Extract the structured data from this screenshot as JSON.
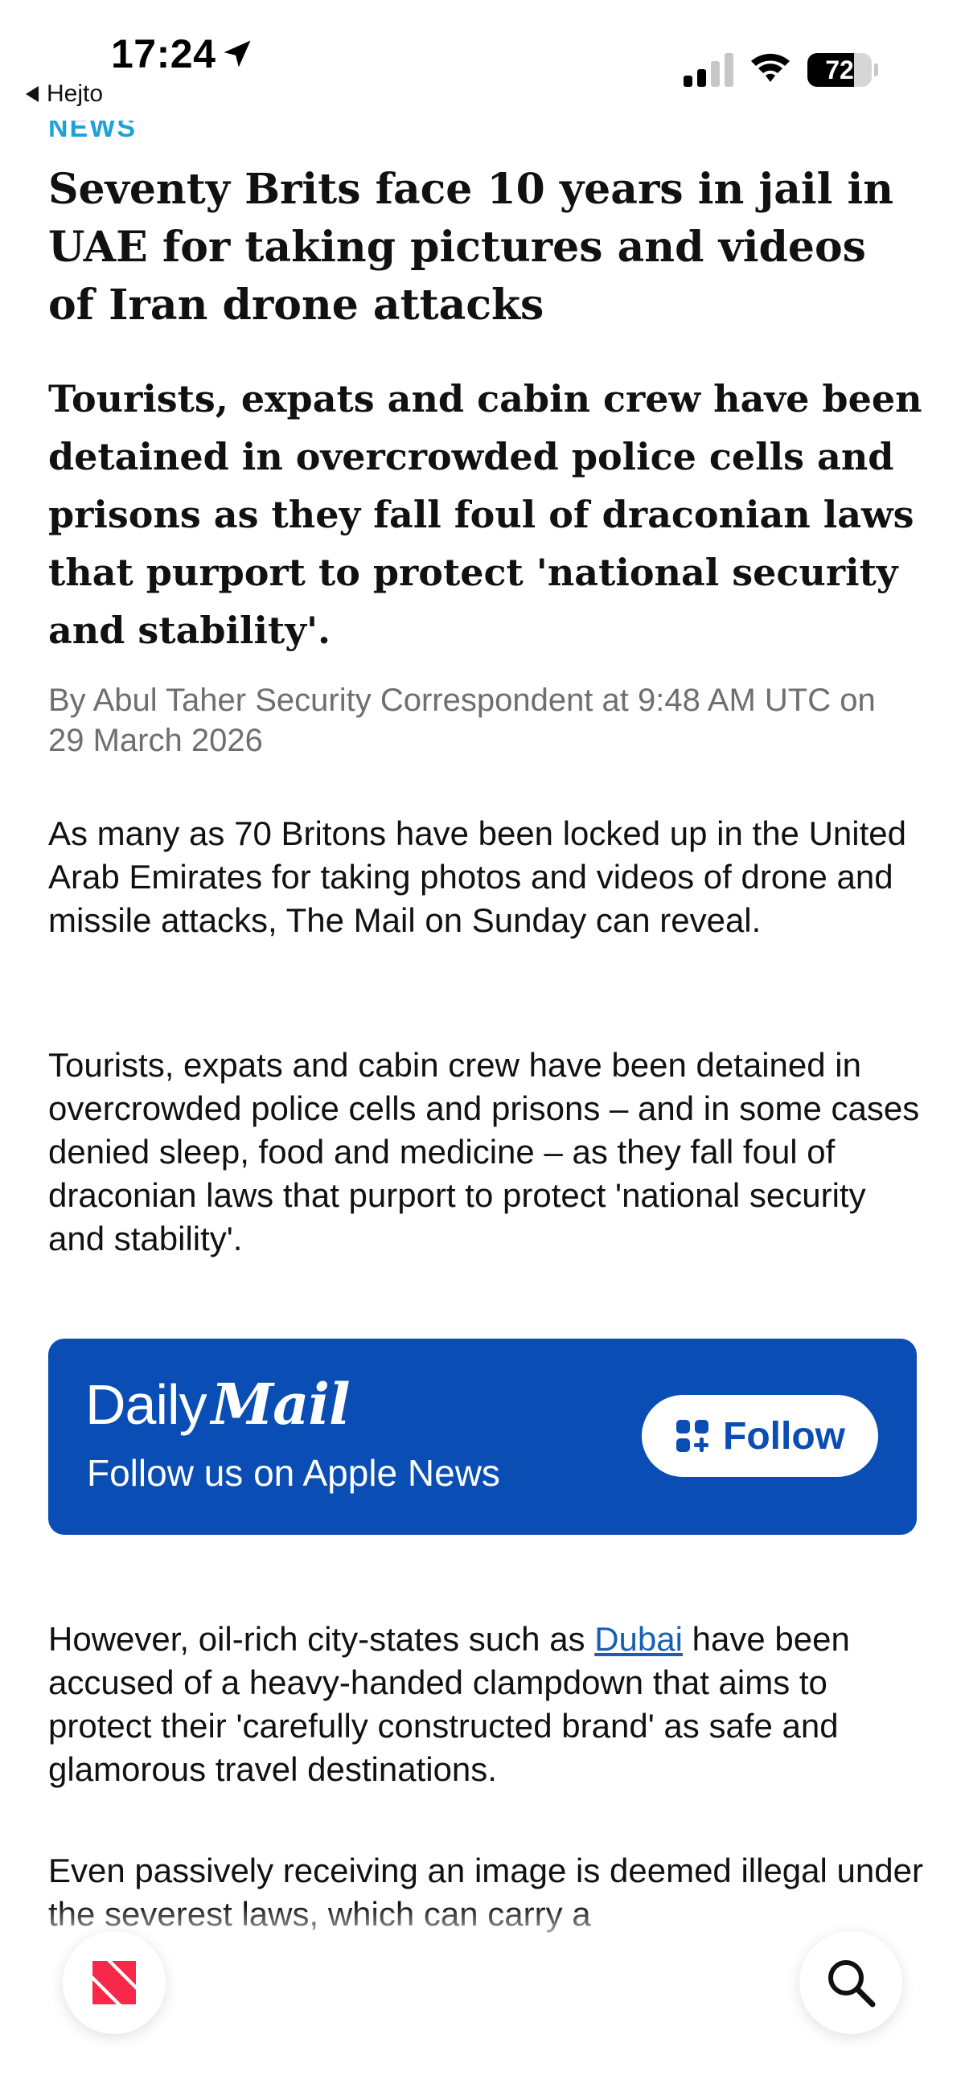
{
  "status_bar": {
    "time": "17:24",
    "back_label": "Hejto",
    "battery_level": 72,
    "battery_text": "72"
  },
  "article": {
    "section": "NEWS",
    "headline": "Seventy Brits face 10 years in jail in UAE for taking pictures and videos of Iran drone attacks",
    "standfirst": "Tourists, expats and cabin crew have been detained in overcrowded police cells and prisons as they fall foul of draconian laws that purport to protect 'national security and stability'.",
    "byline": "By Abul Taher Security Correspondent at 9:48 AM UTC on 29 March 2026",
    "paragraphs": [
      "As many as 70 Britons have been locked up in the United Arab Emirates for taking photos and videos of drone and missile attacks, The Mail on Sunday can reveal.",
      "Tourists, expats and cabin crew have been detained in overcrowded police cells and prisons – and in some cases denied sleep, food and medicine – as they fall foul of draconian laws that purport to protect 'national security and stability'."
    ],
    "para3_before": "However, oil-rich city-states such as ",
    "para3_link": "Dubai",
    "para3_after": " have been accused of a heavy-handed clampdown that aims to protect their 'carefully constructed brand' as safe and glamorous travel destinations.",
    "para4": "Even passively receiving an image is deemed illegal under the severest laws, which can carry a"
  },
  "promo": {
    "brand_daily": "Daily",
    "brand_mail": "Mail",
    "tagline": "Follow us on Apple News",
    "follow_label": "Follow",
    "background_color": "#0a4db4"
  },
  "icons": {
    "location": "location-arrow-icon",
    "signal": "cellular-signal-icon",
    "wifi": "wifi-icon",
    "battery": "battery-icon",
    "apple_news": "apple-news-icon",
    "search": "search-icon",
    "follow": "follow-plus-icon"
  }
}
